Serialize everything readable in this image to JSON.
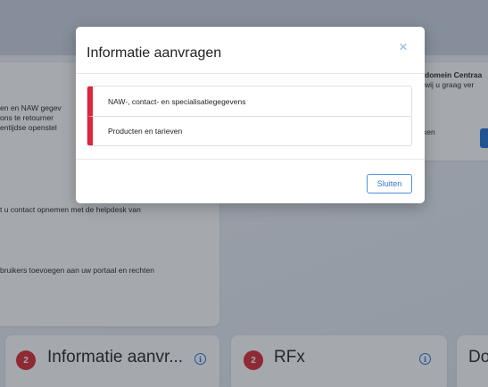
{
  "background": {
    "left_card_lines": [
      "en en NAW gegev",
      " ons te retourner",
      "entijdse openstel",
      "t u contact opnemen met de helpdesk van",
      " bruikers toevoegen aan uw portaal en rechten"
    ],
    "right_card": {
      "title": "domein Centraa",
      "line": " wij u graag ver",
      "line2": "ken"
    },
    "tiles": [
      {
        "badge": "2",
        "title": "Informatie aanvr...",
        "icon": "info-icon"
      },
      {
        "badge": "2",
        "title": "RFx",
        "icon": "info-icon"
      },
      {
        "title": "Do"
      }
    ]
  },
  "modal": {
    "title": "Informatie aanvragen",
    "close_symbol": "×",
    "items": [
      {
        "label": "NAW-, contact- en specialisatiegegevens"
      },
      {
        "label": "Producten en tarieven"
      }
    ],
    "footer_button": "Sluiten"
  },
  "colors": {
    "accent": "#e0243a",
    "primary": "#2c74cf",
    "badge": "#d8262e"
  }
}
